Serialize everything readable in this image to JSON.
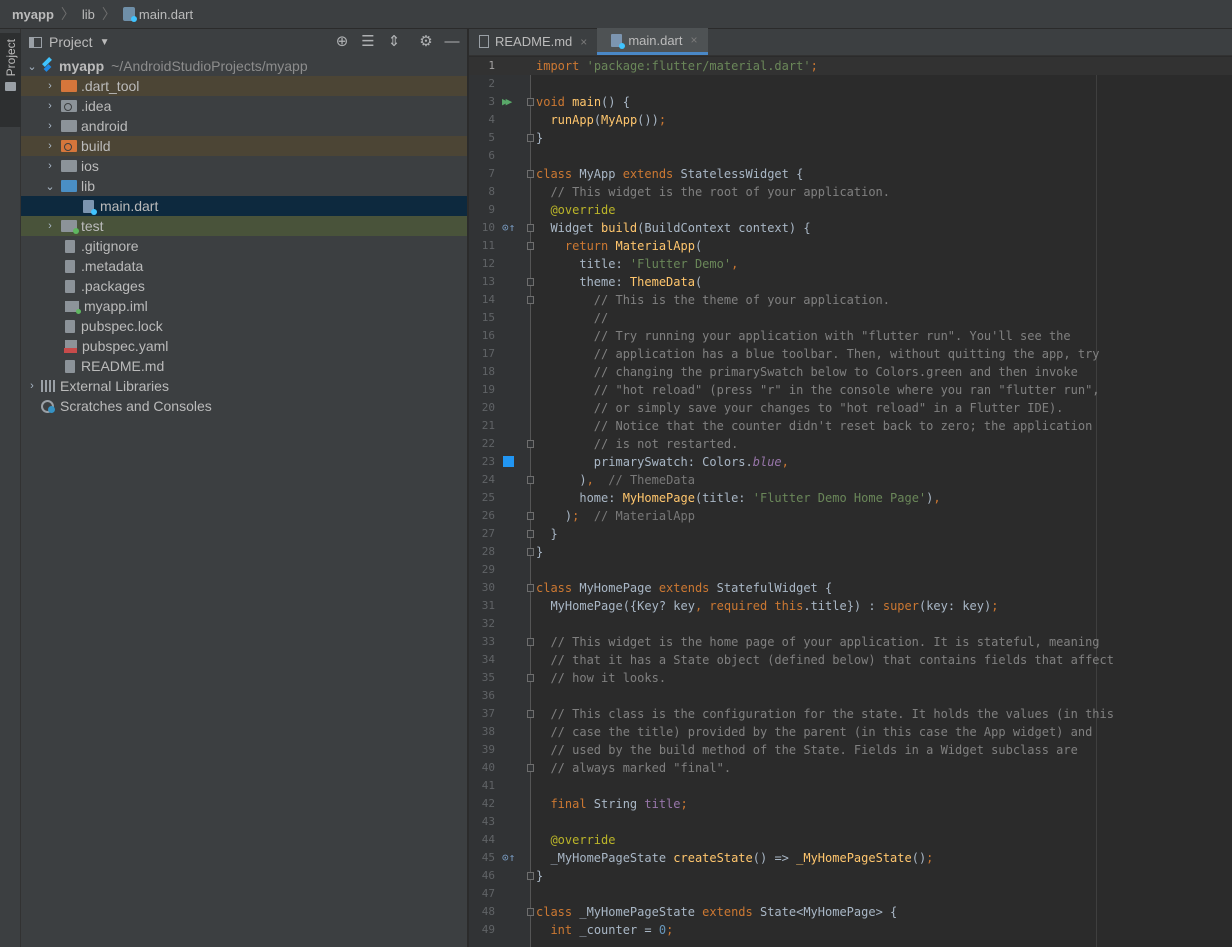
{
  "breadcrumb": {
    "items": [
      "myapp",
      "lib",
      "main.dart"
    ]
  },
  "toolstrip": {
    "project_tab": "Project"
  },
  "project_panel": {
    "title": "Project",
    "tool_icons": [
      "locate-icon",
      "expand-all-icon",
      "collapse-all-icon",
      "settings-icon",
      "hide-icon"
    ],
    "root": {
      "name": "myapp",
      "path": "~/AndroidStudioProjects/myapp"
    },
    "items": [
      {
        "label": ".dart_tool",
        "icon": "folder-excluded-icon"
      },
      {
        "label": ".idea",
        "icon": "folder-config-icon"
      },
      {
        "label": "android",
        "icon": "folder-icon"
      },
      {
        "label": "build",
        "icon": "folder-excluded-icon"
      },
      {
        "label": "ios",
        "icon": "folder-icon"
      },
      {
        "label": "lib",
        "icon": "folder-source-icon"
      },
      {
        "label": "main.dart",
        "icon": "dart-file-icon"
      },
      {
        "label": "test",
        "icon": "folder-test-icon"
      },
      {
        "label": ".gitignore",
        "icon": "text-file-icon"
      },
      {
        "label": ".metadata",
        "icon": "text-file-icon"
      },
      {
        "label": ".packages",
        "icon": "text-file-icon"
      },
      {
        "label": "myapp.iml",
        "icon": "module-file-icon"
      },
      {
        "label": "pubspec.lock",
        "icon": "text-file-icon"
      },
      {
        "label": "pubspec.yaml",
        "icon": "yaml-file-icon"
      },
      {
        "label": "README.md",
        "icon": "text-file-icon"
      }
    ],
    "external_libraries": "External Libraries",
    "scratches": "Scratches and Consoles"
  },
  "editor": {
    "tabs": [
      {
        "label": "README.md",
        "active": false
      },
      {
        "label": "main.dart",
        "active": true
      }
    ],
    "lines": [
      "import 'package:flutter/material.dart';",
      "",
      "void main() {",
      "  runApp(MyApp());",
      "}",
      "",
      "class MyApp extends StatelessWidget {",
      "  // This widget is the root of your application.",
      "  @override",
      "  Widget build(BuildContext context) {",
      "    return MaterialApp(",
      "      title: 'Flutter Demo',",
      "      theme: ThemeData(",
      "        // This is the theme of your application.",
      "        //",
      "        // Try running your application with \"flutter run\". You'll see the",
      "        // application has a blue toolbar. Then, without quitting the app, try",
      "        // changing the primarySwatch below to Colors.green and then invoke",
      "        // \"hot reload\" (press \"r\" in the console where you ran \"flutter run\",",
      "        // or simply save your changes to \"hot reload\" in a Flutter IDE).",
      "        // Notice that the counter didn't reset back to zero; the application",
      "        // is not restarted.",
      "        primarySwatch: Colors.blue,",
      "      ),  // ThemeData",
      "      home: MyHomePage(title: 'Flutter Demo Home Page'),",
      "    );  // MaterialApp",
      "  }",
      "}",
      "",
      "class MyHomePage extends StatefulWidget {",
      "  MyHomePage({Key? key, required this.title}) : super(key: key);",
      "",
      "  // This widget is the home page of your application. It is stateful, meaning",
      "  // that it has a State object (defined below) that contains fields that affect",
      "  // how it looks.",
      "",
      "  // This class is the configuration for the state. It holds the values (in this",
      "  // case the title) provided by the parent (in this case the App widget) and",
      "  // used by the build method of the State. Fields in a Widget subclass are",
      "  // always marked \"final\".",
      "",
      "  final String title;",
      "",
      "  @override",
      "  _MyHomePageState createState() => _MyHomePageState();",
      "}",
      "",
      "class _MyHomePageState extends State<MyHomePage> {",
      "  int _counter = 0;"
    ],
    "colors": {
      "keyword": "#cc7832",
      "string": "#6a8759",
      "comment": "#808080",
      "function": "#ffc66d",
      "annotation": "#bbb529",
      "field": "#9876aa",
      "number": "#6897bb",
      "swatch": "#2196f3"
    }
  }
}
